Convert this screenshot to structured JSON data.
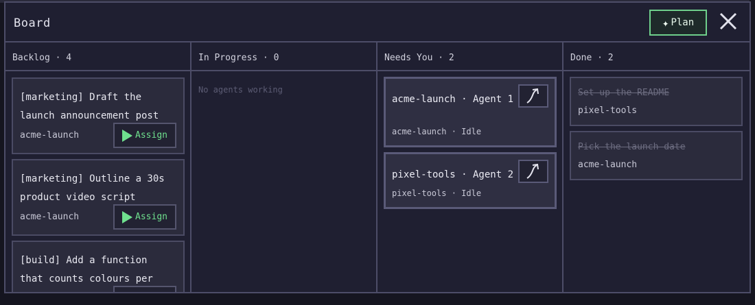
{
  "board": {
    "title": "Board",
    "plan_label": "Plan",
    "plan_icon": "sparkle-icon",
    "close_icon": "close-icon"
  },
  "columns": [
    {
      "title": "Backlog · 4"
    },
    {
      "title": "In Progress · 0",
      "empty_text": "No agents working"
    },
    {
      "title": "Needs You · 2"
    },
    {
      "title": "Done · 2"
    }
  ],
  "backlog": [
    {
      "title": "[marketing] Draft the launch announcement post",
      "project": "acme-launch",
      "action": "Assign"
    },
    {
      "title": "[marketing] Outline a 30s product video script",
      "project": "acme-launch",
      "action": "Assign"
    },
    {
      "title": "[build] Add a function that counts colours per row",
      "project": "",
      "action": ""
    }
  ],
  "needs_you": [
    {
      "title": "acme-launch · Agent 1",
      "status": "acme-launch · Idle"
    },
    {
      "title": "pixel-tools · Agent 2",
      "status": "pixel-tools · Idle"
    }
  ],
  "done": [
    {
      "title": "Set up the README",
      "project": "pixel-tools"
    },
    {
      "title": "Pick the launch date",
      "project": "acme-launch"
    }
  ],
  "colors": {
    "accent": "#6fe08e",
    "panel": "#1f1f31",
    "border": "#4d4d68"
  }
}
